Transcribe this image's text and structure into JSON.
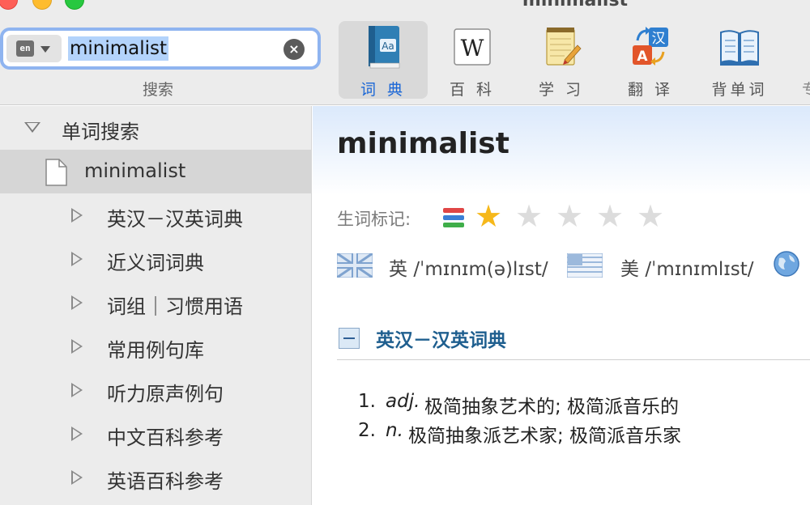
{
  "window": {
    "title": "minimalist"
  },
  "search": {
    "lang_code": "en",
    "query": "minimalist",
    "caption": "搜索"
  },
  "toolbar": {
    "buttons": [
      {
        "label": "词 典",
        "icon": "dictionary-book-icon",
        "active": true
      },
      {
        "label": "百 科",
        "icon": "wikipedia-icon",
        "active": false
      },
      {
        "label": "学 习",
        "icon": "notepad-pencil-icon",
        "active": false
      },
      {
        "label": "翻 译",
        "icon": "translate-icon",
        "active": false
      },
      {
        "label": "背单词",
        "icon": "open-book-icon",
        "active": false
      }
    ],
    "translate_glyphs": {
      "zh": "汉",
      "en": "A"
    },
    "wiki_glyph": "W",
    "dict_glyph": "Aa",
    "cut_label": "专"
  },
  "sidebar": {
    "group_label": "单词搜索",
    "selected_item": "minimalist",
    "items": [
      {
        "label": "英汉－汉英词典"
      },
      {
        "label": "近义词词典"
      },
      {
        "label": "词组｜习惯用语"
      },
      {
        "label": "常用例句库"
      },
      {
        "label": "听力原声例句"
      },
      {
        "label": "中文百科参考"
      },
      {
        "label": "英语百科参考"
      }
    ]
  },
  "entry": {
    "headword": "minimalist",
    "wordmark_label": "生词标记:",
    "rating": 1,
    "rating_max": 5,
    "pronunciations": [
      {
        "region": "英",
        "ipa": "/ˈmɪnɪm(ə)lɪst/",
        "flag": "uk-flag-icon"
      },
      {
        "region": "美",
        "ipa": "/ˈmɪnɪmlɪst/",
        "flag": "us-flag-icon"
      }
    ],
    "section_title": "英汉－汉英词典",
    "definitions": [
      {
        "num": "1.",
        "pos": "adj.",
        "text": "极简抽象艺术的; 极简派音乐的"
      },
      {
        "num": "2.",
        "pos": "n.",
        "text": "极简抽象派艺术家; 极简派音乐家"
      }
    ]
  },
  "colors": {
    "accent": "#1a66d6",
    "search_focus": "#8fb4f0",
    "selection": "#b3d3fb",
    "star": "#f6b81a",
    "section_title": "#1f5f8f"
  }
}
